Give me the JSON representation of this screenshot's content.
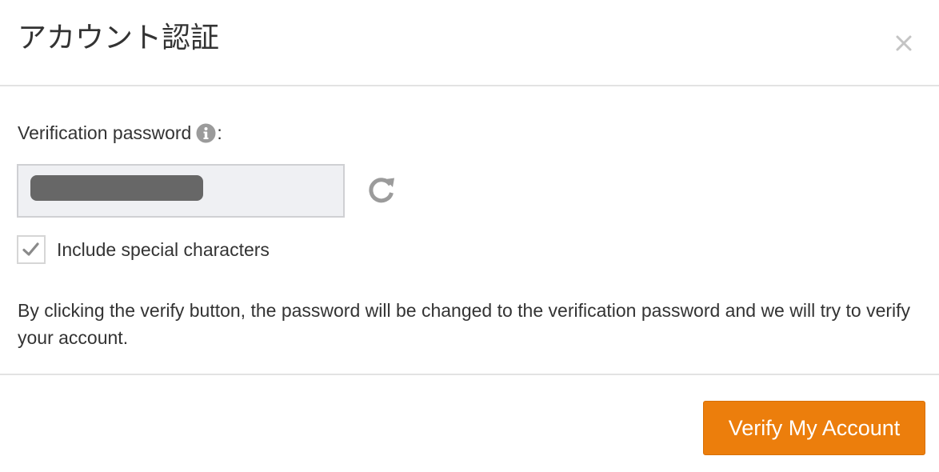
{
  "dialog": {
    "title": "アカウント認証",
    "close_icon": "close-icon"
  },
  "password_field": {
    "label": "Verification password",
    "label_suffix": ":",
    "info_icon": "info-icon",
    "value": "••••••••••••••",
    "refresh_icon": "refresh-icon"
  },
  "special_characters": {
    "label": "Include special characters",
    "checked": true
  },
  "description": "By clicking the verify button, the password will be changed to the verification password and we will try to verify your account.",
  "footer": {
    "verify_label": "Verify My Account"
  },
  "colors": {
    "accent": "#ec7e0c",
    "input_background": "#eff0f3",
    "masked_text": "#676767",
    "icon_gray": "#9b9b9b"
  }
}
